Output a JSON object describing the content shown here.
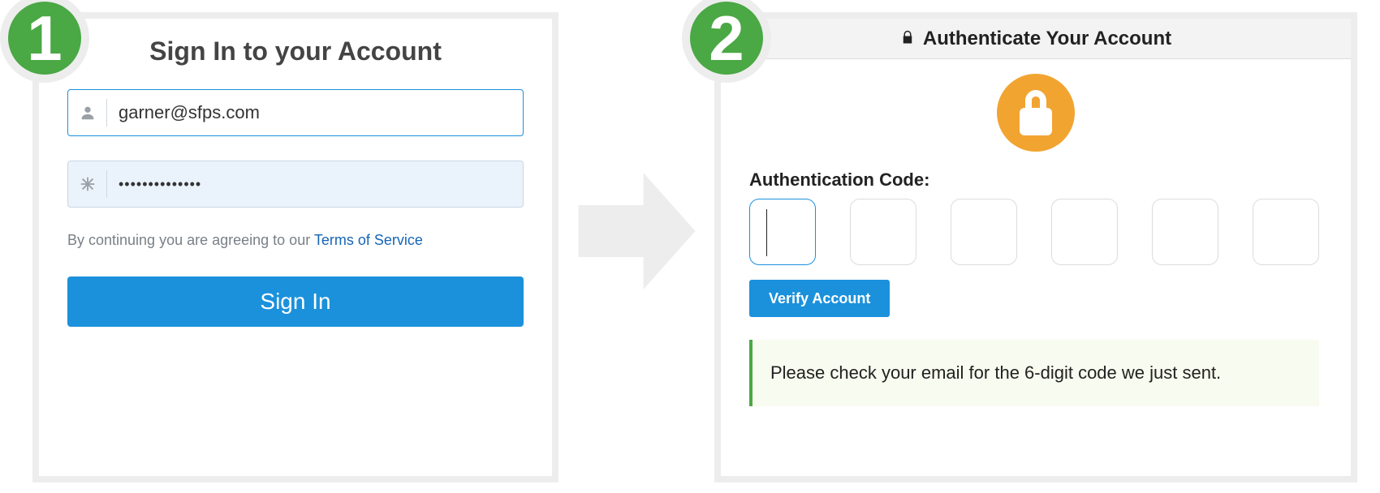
{
  "step1": {
    "number": "1",
    "title": "Sign In to your Account",
    "email_value": "garner@sfps.com",
    "password_value": "••••••••••••••",
    "tos_prefix": "By continuing you are agreeing to our ",
    "tos_link_text": "Terms of Service",
    "signin_button": "Sign In"
  },
  "step2": {
    "number": "2",
    "title": "Authenticate Your Account",
    "code_label": "Authentication Code:",
    "verify_button": "Verify Account",
    "info_message": "Please check your email for the 6-digit code we just sent."
  },
  "colors": {
    "accent_blue": "#1b91dc",
    "accent_green": "#4aa845",
    "lock_orange": "#f2a431",
    "panel_border": "#ededed"
  }
}
